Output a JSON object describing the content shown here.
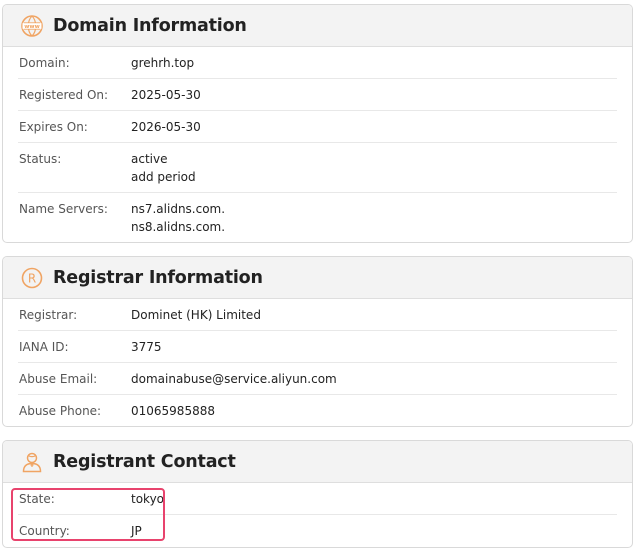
{
  "domain_info": {
    "title": "Domain Information",
    "icon": "www-globe-icon",
    "rows": [
      {
        "label": "Domain:",
        "values": [
          "grehrh.top"
        ]
      },
      {
        "label": "Registered On:",
        "values": [
          "2025-05-30"
        ]
      },
      {
        "label": "Expires On:",
        "values": [
          "2026-05-30"
        ]
      },
      {
        "label": "Status:",
        "values": [
          "active",
          "add period"
        ]
      },
      {
        "label": "Name Servers:",
        "values": [
          "ns7.alidns.com.",
          "ns8.alidns.com."
        ]
      }
    ]
  },
  "registrar_info": {
    "title": "Registrar Information",
    "icon": "registered-icon",
    "rows": [
      {
        "label": "Registrar:",
        "values": [
          "Dominet (HK) Limited"
        ]
      },
      {
        "label": "IANA ID:",
        "values": [
          "3775"
        ]
      },
      {
        "label": "Abuse Email:",
        "values": [
          "domainabuse@service.aliyun.com"
        ]
      },
      {
        "label": "Abuse Phone:",
        "values": [
          "01065985888"
        ]
      }
    ]
  },
  "registrant_contact": {
    "title": "Registrant Contact",
    "icon": "person-icon",
    "rows": [
      {
        "label": "State:",
        "values": [
          "tokyo"
        ]
      },
      {
        "label": "Country:",
        "values": [
          "JP"
        ]
      }
    ]
  },
  "colors": {
    "accent_icon": "#f0a463",
    "highlight_border": "#e8436d"
  }
}
